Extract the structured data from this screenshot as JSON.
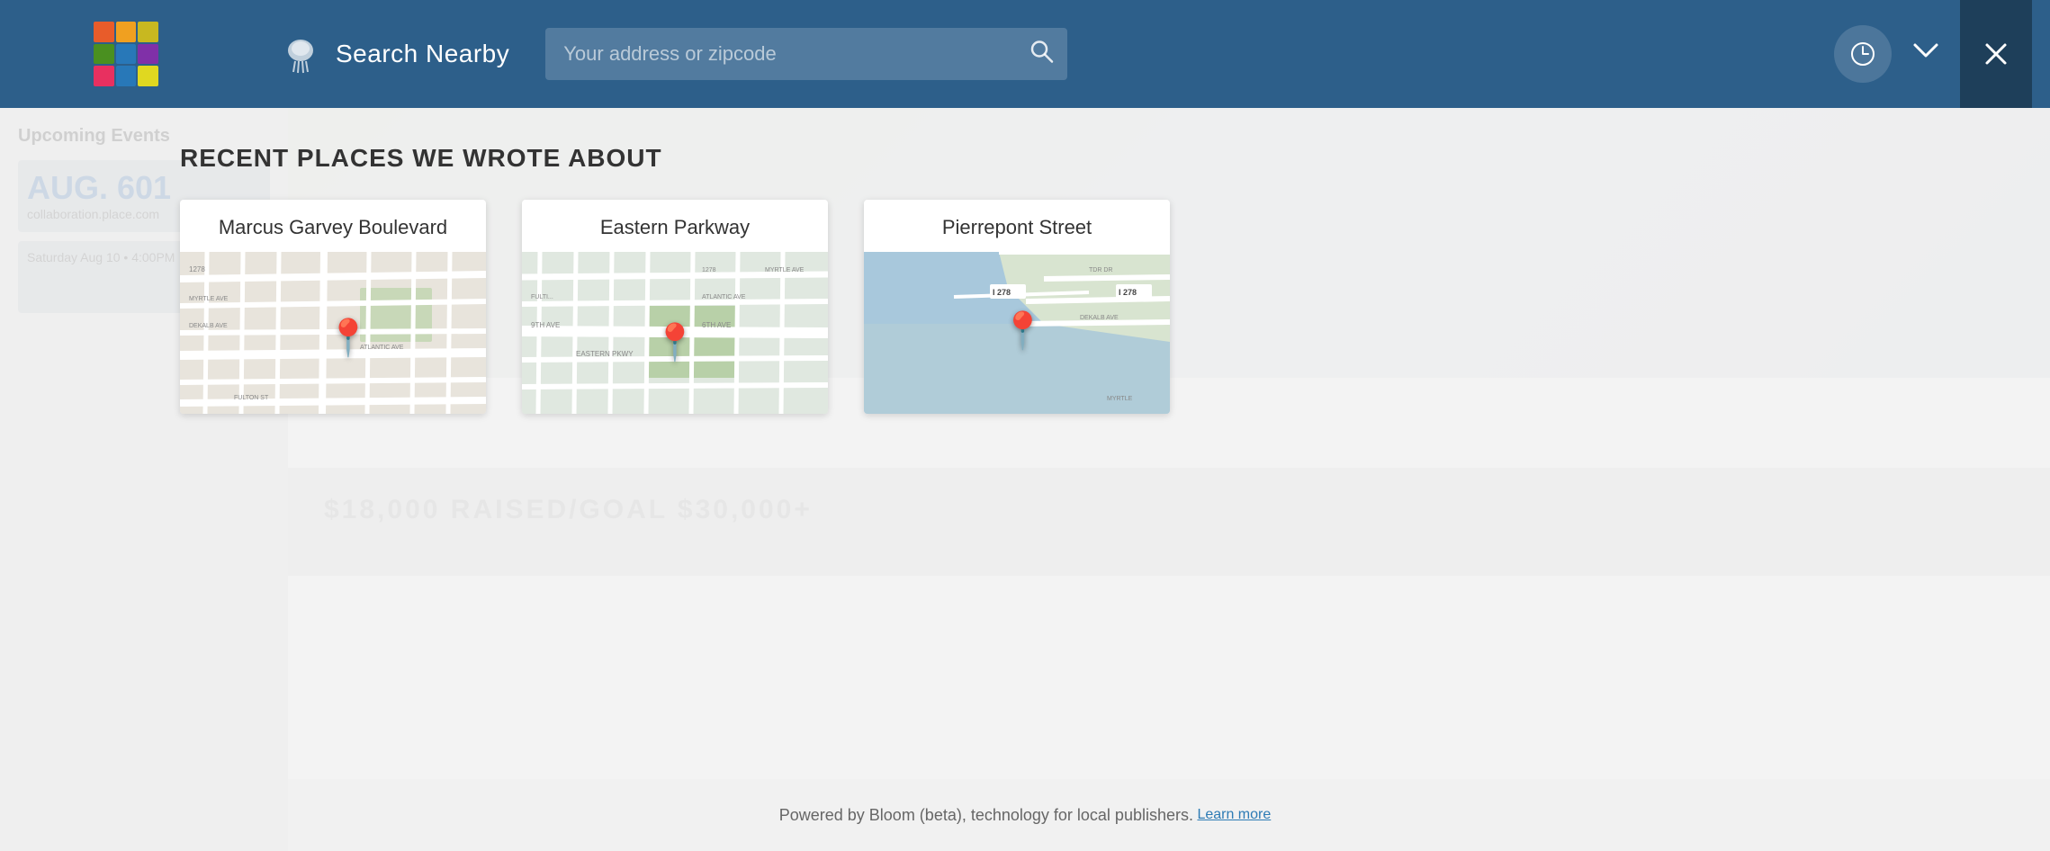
{
  "header": {
    "search_nearby_label": "Search Nearby",
    "search_placeholder": "Your address or zipcode"
  },
  "logo": {
    "colors": [
      "#e85c2a",
      "#f0a020",
      "#c8b820",
      "#4a9020",
      "#2878b8",
      "#8030a8",
      "#e83060",
      "#2878b8",
      "#e0d820"
    ]
  },
  "section": {
    "title": "RECENT PLACES WE WROTE ABOUT"
  },
  "places": [
    {
      "name": "Marcus Garvey Boulevard",
      "map_style": "brooklyn1",
      "pin_left": "55%",
      "pin_top": "50%"
    },
    {
      "name": "Eastern Parkway",
      "map_style": "brooklyn2",
      "pin_left": "52%",
      "pin_top": "55%"
    },
    {
      "name": "Pierrepont Street",
      "map_style": "brooklyn3",
      "pin_left": "50%",
      "pin_top": "50%"
    }
  ],
  "footer": {
    "text": "Powered by Bloom (beta), technology for local publishers.",
    "link_text": "Learn more"
  },
  "buttons": {
    "close_label": "×",
    "chevron_label": "∨",
    "clock_label": "🕐"
  }
}
